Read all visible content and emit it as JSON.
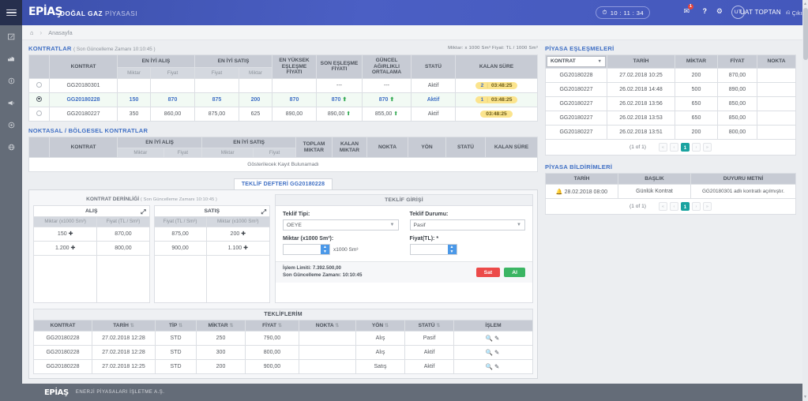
{
  "header": {
    "logo": "EPİAŞ",
    "title_bold": "DOĞAL GAZ",
    "title_light": "PİYASASI",
    "clock": "10 : 11 : 34",
    "clock_icon": "clock-icon",
    "mail_icon": "mail-icon",
    "mail_badge": "1",
    "help_icon": "question-icon",
    "gear_icon": "gear-icon",
    "avatar_initials": "UT",
    "user_name": "UAT TOPTAN",
    "logout": "Çıkış",
    "logout_icon": "power-icon",
    "menu_icon": "hamburger-icon"
  },
  "sidebar": {
    "items": [
      {
        "name": "sidebar-item-teklif",
        "icon": "edit-square-icon"
      },
      {
        "name": "sidebar-item-piyasa",
        "icon": "chart-bars-icon"
      },
      {
        "name": "sidebar-item-islem",
        "icon": "coin-icon"
      },
      {
        "name": "sidebar-item-duyuru",
        "icon": "megaphone-icon"
      },
      {
        "name": "sidebar-item-ayarlar",
        "icon": "circle-gear-icon"
      },
      {
        "name": "sidebar-item-yardim",
        "icon": "globe-icon"
      }
    ]
  },
  "breadcrumb": {
    "home_icon": "home-icon",
    "label": "Anasayfa"
  },
  "kontratlar": {
    "title": "KONTRATLAR",
    "subtitle": "( Son Güncelleme Zamanı 10:10:45 )",
    "unit_note": "Miktar:  x 1000 Sm³   Fiyat:  TL / 1000 Sm³",
    "group_headers": {
      "alis": "EN İYİ ALIŞ",
      "satis": "EN İYİ SATIŞ"
    },
    "headers": [
      "",
      "KONTRAT",
      "Miktar",
      "Fiyat",
      "Fiyat",
      "Miktar",
      "EN YÜKSEK EŞLEŞME FİYATI",
      "SON EŞLEŞME FİYATI",
      "GÜNCEL AĞIRLIKLI ORTALAMA",
      "STATÜ",
      "KALAN SÜRE"
    ],
    "rows": [
      {
        "selected": false,
        "kontrat": "GG20180301",
        "alis_miktar": "",
        "alis_fiyat": "",
        "satis_fiyat": "",
        "satis_miktar": "",
        "en_yuksek": "",
        "son_eslesme": "---",
        "guncel_ort": "---",
        "statu": "Aktif",
        "kalan_n": "2",
        "kalan": "03:48:25",
        "son_up": false,
        "ort_up": false
      },
      {
        "selected": true,
        "kontrat": "GG20180228",
        "alis_miktar": "150",
        "alis_fiyat": "870",
        "satis_fiyat": "875",
        "satis_miktar": "200",
        "en_yuksek": "870",
        "son_eslesme": "870",
        "guncel_ort": "870",
        "statu": "Aktif",
        "kalan_n": "1",
        "kalan": "03:48:25",
        "son_up": true,
        "ort_up": true
      },
      {
        "selected": false,
        "kontrat": "GG20180227",
        "alis_miktar": "350",
        "alis_fiyat": "860,00",
        "satis_fiyat": "875,00",
        "satis_miktar": "625",
        "en_yuksek": "890,00",
        "son_eslesme": "890,00",
        "guncel_ort": "855,00",
        "statu": "Aktif",
        "kalan_n": "",
        "kalan": "03:48:25",
        "son_up": true,
        "ort_up": true
      }
    ]
  },
  "noktasal": {
    "title": "NOKTASAL / BÖLGESEL KONTRATLAR",
    "group_headers": {
      "alis": "EN İYİ ALIŞ",
      "satis": "EN İYİ SATIŞ"
    },
    "headers": [
      "",
      "KONTRAT",
      "Miktar",
      "Fiyat",
      "Miktar",
      "Fiyat",
      "TOPLAM MIKTAR",
      "KALAN MIKTAR",
      "NOKTA",
      "YÖN",
      "STATÜ",
      "KALAN SÜRE"
    ],
    "empty_text": "Gösterilecek Kayıt Bulunamadı"
  },
  "teklif_defteri": {
    "tab_label": "TEKLİF DEFTERİ GG20180228",
    "depth_title": "KONTRAT DERİNLİĞİ",
    "depth_subtitle": "( Son Güncelleme Zamanı 10:10:45 )",
    "alis_label": "ALIŞ",
    "satis_label": "SATIŞ",
    "expand_icon": "expand-icon",
    "alis_headers": [
      "Miktar (x1000 Sm³)",
      "Fiyat (TL / Sm³)"
    ],
    "satis_headers": [
      "Fiyat (TL / Sm³)",
      "Miktar (x1000 Sm³)"
    ],
    "alis_rows": [
      {
        "miktar": "150",
        "fiyat": "870,00"
      },
      {
        "miktar": "1.200",
        "fiyat": "800,00"
      }
    ],
    "satis_rows": [
      {
        "fiyat": "875,00",
        "miktar": "200"
      },
      {
        "fiyat": "900,00",
        "miktar": "1.100"
      }
    ]
  },
  "teklif_girisi": {
    "title": "TEKLİF GİRİŞİ",
    "tip_label": "Teklif Tipi:",
    "tip_value": "OEYE",
    "durum_label": "Teklif Durumu:",
    "durum_value": "Pasif",
    "miktar_label": "Miktar (x1000 Sm³):",
    "miktar_value": "",
    "miktar_unit": "x1000 Sm³",
    "fiyat_label": "Fiyat(TL):  *",
    "fiyat_value": "",
    "islem_limiti": "İşlem Limiti:  7.392.500,00",
    "son_guncelleme": "Son Güncelleme Zamanı: 10:10:45",
    "sell_label": "Sat",
    "buy_label": "Al"
  },
  "tekliflerim": {
    "title": "TEKLİFLERİM",
    "headers": [
      "KONTRAT",
      "TARİH",
      "TİP",
      "MİKTAR",
      "FİYAT",
      "NOKTA",
      "YÖN",
      "STATÜ",
      "İŞLEM"
    ],
    "rows": [
      {
        "kontrat": "GG20180228",
        "tarih": "27.02.2018 12:28",
        "tip": "STD",
        "miktar": "250",
        "fiyat": "790,00",
        "nokta": "",
        "yon": "Alış",
        "statu": "Pasif"
      },
      {
        "kontrat": "GG20180228",
        "tarih": "27.02.2018 12:28",
        "tip": "STD",
        "miktar": "300",
        "fiyat": "800,00",
        "nokta": "",
        "yon": "Alış",
        "statu": "Aktif"
      },
      {
        "kontrat": "GG20180228",
        "tarih": "27.02.2018 12:25",
        "tip": "STD",
        "miktar": "200",
        "fiyat": "900,00",
        "nokta": "",
        "yon": "Satış",
        "statu": "Aktif"
      }
    ],
    "action_icons": [
      "search-icon",
      "edit-icon"
    ]
  },
  "piyasa_eslesmeleri": {
    "title": "PİYASA EŞLEŞMELERİ",
    "filter_label": "KONTRAT",
    "filter_icon": "chevron-down-icon",
    "headers": [
      "KONTRAT",
      "TARİH",
      "MİKTAR",
      "FİYAT",
      "NOKTA"
    ],
    "rows": [
      {
        "kontrat": "GG20180228",
        "tarih": "27.02.2018 10:25",
        "miktar": "200",
        "fiyat": "870,00",
        "nokta": ""
      },
      {
        "kontrat": "GG20180227",
        "tarih": "26.02.2018 14:48",
        "miktar": "500",
        "fiyat": "890,00",
        "nokta": ""
      },
      {
        "kontrat": "GG20180227",
        "tarih": "26.02.2018 13:56",
        "miktar": "650",
        "fiyat": "850,00",
        "nokta": ""
      },
      {
        "kontrat": "GG20180227",
        "tarih": "26.02.2018 13:53",
        "miktar": "650",
        "fiyat": "850,00",
        "nokta": ""
      },
      {
        "kontrat": "GG20180227",
        "tarih": "26.02.2018 13:51",
        "miktar": "200",
        "fiyat": "800,00",
        "nokta": ""
      }
    ],
    "pager": {
      "info": "(1 of 1)",
      "current": "1"
    }
  },
  "piyasa_bildirimleri": {
    "title": "PİYASA BİLDİRİMLERİ",
    "headers": [
      "TARİH",
      "BAŞLIK",
      "DUYURU METNİ"
    ],
    "rows": [
      {
        "icon": "bell-icon",
        "tarih": "28.02.2018 08:00",
        "baslik": "Günlük Kontrat",
        "metin": "GG20180301 adlı kontratlı açılmıştır."
      }
    ],
    "pager": {
      "info": "(1 of 1)",
      "current": "1"
    }
  },
  "footer": {
    "logo": "EPİAŞ",
    "text": "ENERJİ PİYASALARI İŞLETME A.Ş."
  },
  "colors": {
    "accent": "#3f6fc4",
    "header": "#4458bb",
    "teal": "#1aa3a0",
    "sell": "#ec4a49",
    "buy": "#3bb563",
    "pill": "#fbe48d"
  }
}
